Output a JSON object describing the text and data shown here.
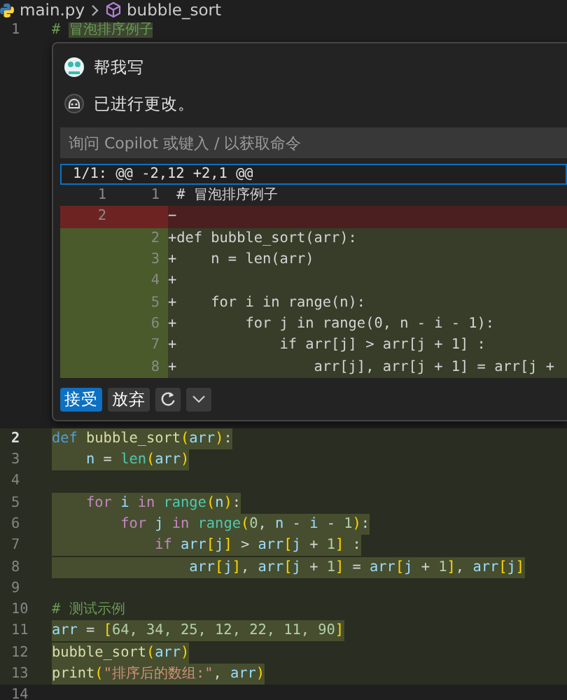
{
  "breadcrumb": {
    "file": "main.py",
    "symbol": "bubble_sort"
  },
  "top_line": {
    "number": "1",
    "tokens": [
      {
        "text": "# ",
        "kind": "comment",
        "highlight": false
      },
      {
        "text": "冒泡排序例子",
        "kind": "comment",
        "highlight": true
      }
    ]
  },
  "chat": {
    "request": "帮我写",
    "response": "已进行更改。",
    "input": {
      "placeholder": "询问 Copilot 或键入 / 以获取命令"
    },
    "diff": {
      "header": "1/1: @@ -2,12 +2,1 @@",
      "lines": [
        {
          "kind": "context",
          "old": "1",
          "new": "1",
          "text": "# 冒泡排序例子"
        },
        {
          "kind": "removed",
          "old": "2",
          "sign": "−"
        },
        {
          "kind": "added",
          "new": "2",
          "sign": "+",
          "text": "def bubble_sort(arr):"
        },
        {
          "kind": "added",
          "new": "3",
          "sign": "+",
          "text": "    n = len(arr)"
        },
        {
          "kind": "added",
          "new": "4",
          "sign": "+"
        },
        {
          "kind": "added",
          "new": "5",
          "sign": "+",
          "text": "    for i in range(n):"
        },
        {
          "kind": "added",
          "new": "6",
          "sign": "+",
          "text": "        for j in range(0, n - i - 1):"
        },
        {
          "kind": "added",
          "new": "7",
          "sign": "+",
          "text": "            if arr[j] > arr[j + 1] :"
        },
        {
          "kind": "added",
          "new": "8",
          "sign": "+",
          "text": "                arr[j], arr[j + 1] = arr[j +"
        }
      ]
    },
    "actions": [
      {
        "kind": "primary",
        "label": "接受"
      },
      {
        "kind": "secondary",
        "label": "放弃"
      },
      {
        "kind": "refresh"
      },
      {
        "kind": "chevron"
      }
    ]
  },
  "lines": [
    {
      "number": "2",
      "current": true,
      "inserted": true,
      "highlighted": true,
      "tokens": [
        {
          "text": "def",
          "kind": "keyword"
        },
        {
          "text": " bubble_sort",
          "kind": "function"
        },
        {
          "text": "(",
          "kind": "bracket"
        },
        {
          "text": "arr",
          "kind": "variable"
        },
        {
          "text": ")",
          "kind": "bracket"
        },
        {
          "text": ":",
          "kind": "plain"
        }
      ]
    },
    {
      "number": "3",
      "current": false,
      "inserted": true,
      "highlighted": true,
      "tokens": [
        {
          "text": "    n",
          "kind": "variable"
        },
        {
          "text": " = ",
          "kind": "plain"
        },
        {
          "text": "len",
          "kind": "builtin"
        },
        {
          "text": "(",
          "kind": "bracket"
        },
        {
          "text": "arr",
          "kind": "variable"
        },
        {
          "text": ")",
          "kind": "bracket"
        }
      ]
    },
    {
      "number": "4",
      "current": false,
      "inserted": true
    },
    {
      "number": "5",
      "current": false,
      "inserted": true,
      "highlighted": true,
      "tokens": [
        {
          "text": "    for",
          "kind": "control"
        },
        {
          "text": " i",
          "kind": "variable"
        },
        {
          "text": " in",
          "kind": "control"
        },
        {
          "text": " range",
          "kind": "builtin"
        },
        {
          "text": "(",
          "kind": "bracket"
        },
        {
          "text": "n",
          "kind": "variable"
        },
        {
          "text": ")",
          "kind": "bracket"
        },
        {
          "text": ":",
          "kind": "plain"
        }
      ]
    },
    {
      "number": "6",
      "current": false,
      "inserted": true,
      "highlighted": true,
      "tokens": [
        {
          "text": "        for",
          "kind": "control"
        },
        {
          "text": " j",
          "kind": "variable"
        },
        {
          "text": " in",
          "kind": "control"
        },
        {
          "text": " range",
          "kind": "builtin"
        },
        {
          "text": "(",
          "kind": "bracket"
        },
        {
          "text": "0",
          "kind": "number"
        },
        {
          "text": ", ",
          "kind": "plain"
        },
        {
          "text": "n",
          "kind": "variable"
        },
        {
          "text": " - ",
          "kind": "plain"
        },
        {
          "text": "i",
          "kind": "variable"
        },
        {
          "text": " - ",
          "kind": "plain"
        },
        {
          "text": "1",
          "kind": "number"
        },
        {
          "text": ")",
          "kind": "bracket"
        },
        {
          "text": ":",
          "kind": "plain"
        }
      ]
    },
    {
      "number": "7",
      "current": false,
      "inserted": true,
      "highlighted": true,
      "tokens": [
        {
          "text": "            if",
          "kind": "control"
        },
        {
          "text": " arr",
          "kind": "variable"
        },
        {
          "text": "[",
          "kind": "bracket"
        },
        {
          "text": "j",
          "kind": "variable"
        },
        {
          "text": "]",
          "kind": "bracket"
        },
        {
          "text": " > ",
          "kind": "plain"
        },
        {
          "text": "arr",
          "kind": "variable"
        },
        {
          "text": "[",
          "kind": "bracket"
        },
        {
          "text": "j",
          "kind": "variable"
        },
        {
          "text": " + ",
          "kind": "plain"
        },
        {
          "text": "1",
          "kind": "number"
        },
        {
          "text": "]",
          "kind": "bracket"
        },
        {
          "text": " :",
          "kind": "plain"
        }
      ]
    },
    {
      "number": "8",
      "current": false,
      "inserted": true,
      "highlighted": true,
      "tokens": [
        {
          "text": "                arr",
          "kind": "variable"
        },
        {
          "text": "[",
          "kind": "bracket"
        },
        {
          "text": "j",
          "kind": "variable"
        },
        {
          "text": "]",
          "kind": "bracket"
        },
        {
          "text": ", ",
          "kind": "plain"
        },
        {
          "text": "arr",
          "kind": "variable"
        },
        {
          "text": "[",
          "kind": "bracket"
        },
        {
          "text": "j",
          "kind": "variable"
        },
        {
          "text": " + ",
          "kind": "plain"
        },
        {
          "text": "1",
          "kind": "number"
        },
        {
          "text": "]",
          "kind": "bracket"
        },
        {
          "text": " = ",
          "kind": "plain"
        },
        {
          "text": "arr",
          "kind": "variable"
        },
        {
          "text": "[",
          "kind": "bracket"
        },
        {
          "text": "j",
          "kind": "variable"
        },
        {
          "text": " + ",
          "kind": "plain"
        },
        {
          "text": "1",
          "kind": "number"
        },
        {
          "text": "]",
          "kind": "bracket"
        },
        {
          "text": ", ",
          "kind": "plain"
        },
        {
          "text": "arr",
          "kind": "variable"
        },
        {
          "text": "[",
          "kind": "bracket"
        },
        {
          "text": "j",
          "kind": "variable"
        },
        {
          "text": "]",
          "kind": "bracket"
        }
      ]
    },
    {
      "number": "9",
      "current": false,
      "inserted": true
    },
    {
      "number": "10",
      "current": false,
      "inserted": true,
      "highlighted": false,
      "tokens": [
        {
          "text": "# 测试示例",
          "kind": "comment"
        }
      ]
    },
    {
      "number": "11",
      "current": false,
      "inserted": true,
      "highlighted": true,
      "tokens": [
        {
          "text": "arr",
          "kind": "variable"
        },
        {
          "text": " = ",
          "kind": "plain"
        },
        {
          "text": "[",
          "kind": "bracket"
        },
        {
          "text": "64, 34, 25, 12, 22, 11, 90",
          "kind": "number"
        },
        {
          "text": "]",
          "kind": "bracket"
        }
      ]
    },
    {
      "number": "12",
      "current": false,
      "inserted": true,
      "highlighted": true,
      "tokens": [
        {
          "text": "bubble_sort",
          "kind": "function"
        },
        {
          "text": "(",
          "kind": "bracket"
        },
        {
          "text": "arr",
          "kind": "variable"
        },
        {
          "text": ")",
          "kind": "bracket"
        }
      ]
    },
    {
      "number": "13",
      "current": false,
      "inserted": true,
      "highlighted": true,
      "tokens": [
        {
          "text": "print",
          "kind": "function"
        },
        {
          "text": "(",
          "kind": "bracket"
        },
        {
          "text": "\"排序后的数组:\"",
          "kind": "string"
        },
        {
          "text": ", ",
          "kind": "plain"
        },
        {
          "text": "arr",
          "kind": "variable"
        },
        {
          "text": ")",
          "kind": "bracket"
        }
      ]
    },
    {
      "number": "14",
      "current": false,
      "inserted": false
    }
  ]
}
